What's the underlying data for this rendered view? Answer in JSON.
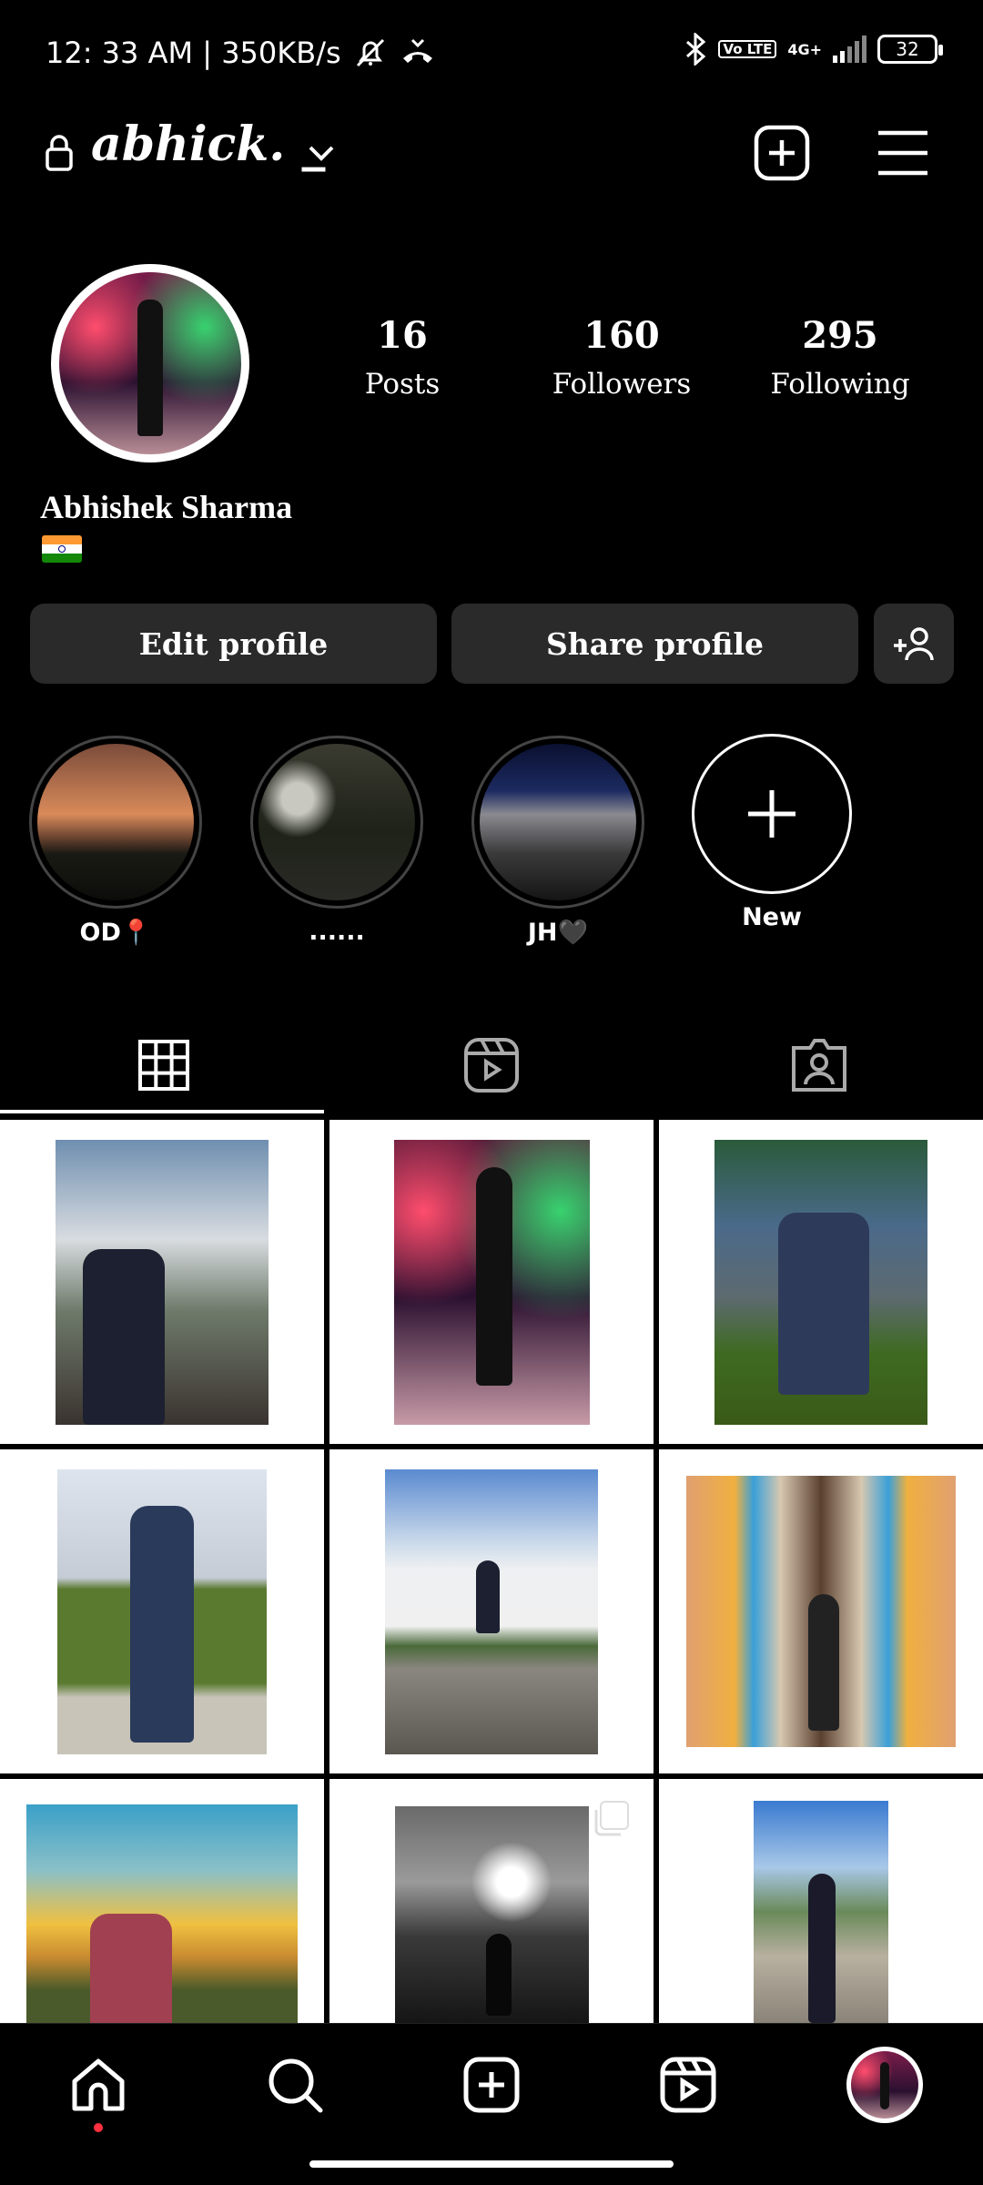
{
  "status_bar": {
    "time_info": "12: 33 AM | 350KB/s",
    "volte": "Vo LTE",
    "network": "4G+",
    "battery": "32"
  },
  "header": {
    "username": "abhick. _",
    "icons": [
      "lock-icon",
      "chevron-down-icon",
      "add-post-icon",
      "menu-icon"
    ]
  },
  "profile": {
    "stats": [
      {
        "value": "16",
        "label": "Posts"
      },
      {
        "value": "160",
        "label": "Followers"
      },
      {
        "value": "295",
        "label": "Following"
      }
    ],
    "full_name": "Abhishek Sharma",
    "bio_flag": "india-flag",
    "edit_label": "Edit profile",
    "share_label": "Share profile"
  },
  "highlights": [
    {
      "label": "OD📍"
    },
    {
      "label": "......"
    },
    {
      "label": "JH🖤"
    },
    {
      "label": "New"
    }
  ],
  "tabs": [
    "grid-icon",
    "reels-icon",
    "tagged-icon"
  ],
  "grid": {
    "posts": 9
  },
  "bottom_nav": [
    "home-icon",
    "search-icon",
    "create-icon",
    "reels-icon",
    "profile-avatar"
  ],
  "colors": {
    "background": "#000000",
    "button": "#2a2a2a",
    "notification_dot": "#ff3040"
  }
}
